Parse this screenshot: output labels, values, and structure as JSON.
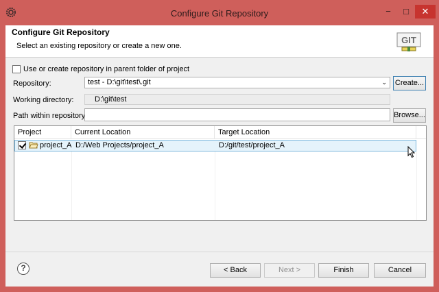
{
  "window": {
    "title": "Configure Git Repository",
    "minimize": "−",
    "maximize": "□",
    "close": "✕"
  },
  "banner": {
    "title": "Configure Git Repository",
    "subtitle": "Select an existing repository or create a new one.",
    "logo_text": "GIT"
  },
  "parent_folder": {
    "label": "Use or create repository in parent folder of project",
    "checked": false
  },
  "repository": {
    "label": "Repository:",
    "value": "test - D:\\git\\test\\.git",
    "create_label": "Create..."
  },
  "working_directory": {
    "label": "Working directory:",
    "value": "D:\\git\\test"
  },
  "path_within": {
    "label": "Path within repository:",
    "value": "",
    "browse_label": "Browse..."
  },
  "table": {
    "columns": [
      "Project",
      "Current Location",
      "Target Location"
    ],
    "rows": [
      {
        "checked": true,
        "project": "project_A",
        "current": "D:/Web Projects/project_A",
        "target": "D:/git/test/project_A"
      }
    ]
  },
  "footer": {
    "help": "?",
    "back": "< Back",
    "next": "Next >",
    "finish": "Finish",
    "cancel": "Cancel"
  },
  "colors": {
    "title_bar": "#cf5f5b",
    "selection": "#e5f3fb",
    "close_button": "#c7342f"
  }
}
